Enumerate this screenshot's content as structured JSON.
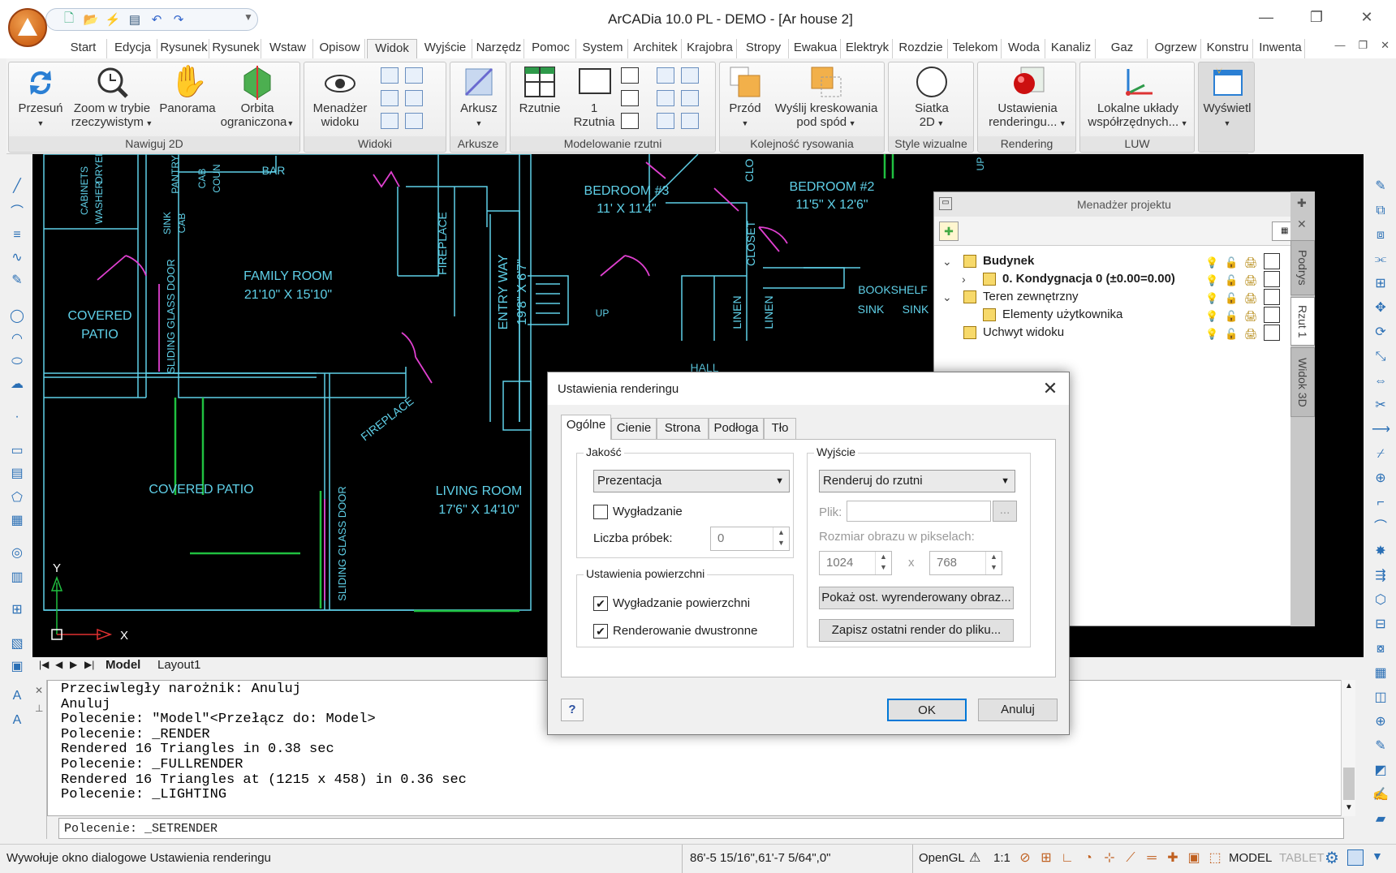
{
  "titlebar": {
    "title": "ArCADia 10.0 PL - DEMO  - [Ar house 2]",
    "qat_icons": [
      "new-icon",
      "open-icon",
      "save-icon",
      "plot-icon",
      "undo-icon",
      "redo-icon"
    ]
  },
  "ribbon_tabs": [
    "Start",
    "Edycja",
    "Rysunek",
    "Rysunek",
    "Wstaw",
    "Opisow",
    "Widok",
    "Wyjście",
    "Narzędz",
    "Pomoc",
    "System",
    "Architek",
    "Krajobra",
    "Stropy",
    "Ewakua",
    "Elektryk",
    "Rozdzie",
    "Telekom",
    "Woda",
    "Kanaliz",
    "Gaz",
    "Ogrzew",
    "Konstru",
    "Inwenta"
  ],
  "active_tab": "Widok",
  "ribbon": {
    "nawiguj": {
      "label": "Nawiguj 2D",
      "przesuń": "Przesuń",
      "zoom1": "Zoom w trybie",
      "zoom2": "rzeczywistym",
      "panorama": "Panorama",
      "orbita1": "Orbita",
      "orbita2": "ograniczona"
    },
    "widoki": {
      "label": "Widoki",
      "menadzer1": "Menadżer",
      "menadzer2": "widoku"
    },
    "arkusze": {
      "label": "Arkusze",
      "arkusz": "Arkusz"
    },
    "modelowanie": {
      "label": "Modelowanie rzutni",
      "rzutnie": "Rzutnie",
      "r1a": "1",
      "r1b": "Rzutnia"
    },
    "kolejnosc": {
      "label": "Kolejność rysowania",
      "przod": "Przód",
      "wyslij1": "Wyślij kreskowania",
      "wyslij2": "pod spód"
    },
    "style": {
      "label": "Style wizualne",
      "siatka1": "Siatka",
      "siatka2": "2D"
    },
    "rendering": {
      "label": "Rendering",
      "ust1": "Ustawienia",
      "ust2": "renderingu..."
    },
    "luw": {
      "label": "LUW",
      "lok1": "Lokalne układy",
      "lok2": "współrzędnych..."
    },
    "wyswietl": {
      "label": "Wyświetl"
    }
  },
  "drawing": {
    "rooms": [
      {
        "name": "FAMILY ROOM",
        "dims": "21'10\" X 15'10\""
      },
      {
        "name": "LIVING ROOM",
        "dims": "17'6\" X 14'10\""
      },
      {
        "name": "BEDROOM #3",
        "dims": "11' X 11'4\""
      },
      {
        "name": "BEDROOM #2",
        "dims": "11'5\" X 12'6\""
      },
      {
        "name": "COVERED",
        "dims": "PATIO"
      },
      {
        "name": "COVERED PATIO",
        "dims": ""
      },
      {
        "name": "ENTRY WAY",
        "dims": "19'8\" X 6'7\""
      }
    ],
    "labels": [
      "BAR",
      "FIREPLACE",
      "FIREPLACE",
      "SLIDING GLASS DOOR",
      "SLIDING GLASS DOOR",
      "CLOSET",
      "CLO",
      "LINEN",
      "LINEN",
      "BOOKSHELF",
      "SINK",
      "SINK",
      "HALL",
      "UP",
      "UP",
      "CABINETS",
      "WASHER",
      "DRYER",
      "PANTRY",
      "SINK",
      "CAB",
      "CAB",
      "COUN"
    ],
    "axis_x": "X",
    "axis_y": "Y"
  },
  "layout_tabs": [
    "Model",
    "Layout1"
  ],
  "project_manager": {
    "title": "Menadżer projektu",
    "items": [
      {
        "label": "Budynek",
        "bold": true
      },
      {
        "label": "0. Kondygnacja 0 (±0.00=0.00)",
        "bold": true
      },
      {
        "label": "Teren zewnętrzny",
        "bold": false
      },
      {
        "label": "Elementy użytkownika",
        "bold": false
      },
      {
        "label": "Uchwyt widoku",
        "bold": false
      }
    ],
    "side_tabs": [
      "Podrys",
      "Rzut 1",
      "Widok 3D"
    ]
  },
  "dialog": {
    "title": "Ustawienia renderingu",
    "tabs": [
      "Ogólne",
      "Cienie",
      "Strona",
      "Podłoga",
      "Tło"
    ],
    "active_tab": "Ogólne",
    "jakosc": {
      "label": "Jakość",
      "preset": "Prezentacja",
      "smoothing": "Wygładzanie",
      "smoothing_checked": false,
      "samples_label": "Liczba próbek:",
      "samples": "0"
    },
    "wyjscie": {
      "label": "Wyjście",
      "target": "Renderuj do rzutni",
      "file_label": "Plik:",
      "file_value": "",
      "browse": "...",
      "size_label": "Rozmiar obrazu w pikselach:",
      "width": "1024",
      "x": "x",
      "height": "768",
      "show_last": "Pokaż ost. wyrenderowany obraz...",
      "save_last": "Zapisz ostatni render do pliku..."
    },
    "powierzchnia": {
      "label": "Ustawienia powierzchni",
      "surf_smooth": "Wygładzanie powierzchni",
      "surf_checked": true,
      "double_sided": "Renderowanie dwustronne",
      "double_checked": true
    },
    "help": "?",
    "ok": "OK",
    "cancel": "Anuluj"
  },
  "command": {
    "history": [
      "Przeciwległy narożnik: Anuluj",
      "Anuluj",
      "Polecenie: \"Model\"<Przełącz do: Model>",
      "Polecenie: _RENDER",
      "Rendered 16 Triangles in 0.38 sec",
      "Polecenie: _FULLRENDER",
      "Rendered 16 Triangles at (1215 x 458) in 0.36 sec",
      "Polecenie: _LIGHTING"
    ],
    "input": "Polecenie: _SETRENDER"
  },
  "status": {
    "hint": "Wywołuje okno dialogowe Ustawienia renderingu",
    "coords": "86'-5 15/16\",61'-7 5/64\",0\"",
    "renderer": "OpenGL",
    "scale": "1:1",
    "model": "MODEL",
    "tablet": "TABLET"
  },
  "colors": {
    "accent": "#0078d7",
    "drawing_lines": "#5fd0e8",
    "doors": "#e040d0",
    "walls_green": "#20c040",
    "canvas_bg": "#000000"
  }
}
